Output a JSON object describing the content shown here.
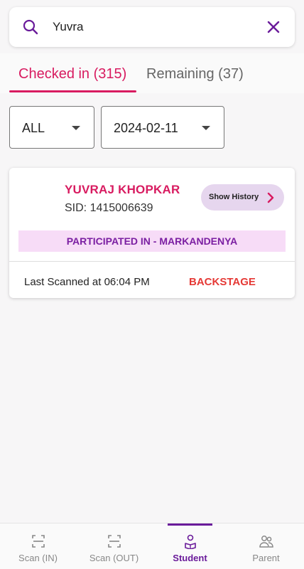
{
  "search": {
    "value": "Yuvra",
    "search_icon": "search-icon",
    "clear_icon": "close-icon"
  },
  "tabs": [
    {
      "label": "Checked in (315)",
      "active": true
    },
    {
      "label": "Remaining (37)",
      "active": false
    }
  ],
  "filters": {
    "category": "ALL",
    "date": "2024-02-11"
  },
  "student_card": {
    "name": "YUVRAJ KHOPKAR",
    "sid": "SID: 1415006639",
    "history_button": "Show History",
    "participated": "PARTICIPATED IN - MARKANDENYA",
    "last_scanned": "Last Scanned at 06:04 PM",
    "location": "BACKSTAGE"
  },
  "bottom_nav": [
    {
      "label": "Scan (IN)",
      "icon": "scan-icon",
      "active": false
    },
    {
      "label": "Scan (OUT)",
      "icon": "scan-icon",
      "active": false
    },
    {
      "label": "Student",
      "icon": "student-icon",
      "active": true
    },
    {
      "label": "Parent",
      "icon": "parent-icon",
      "active": false
    }
  ],
  "colors": {
    "accent": "#d81b60",
    "primary": "#6a1b9a",
    "banner_bg": "#f7dcf7",
    "alert": "#e53935"
  }
}
